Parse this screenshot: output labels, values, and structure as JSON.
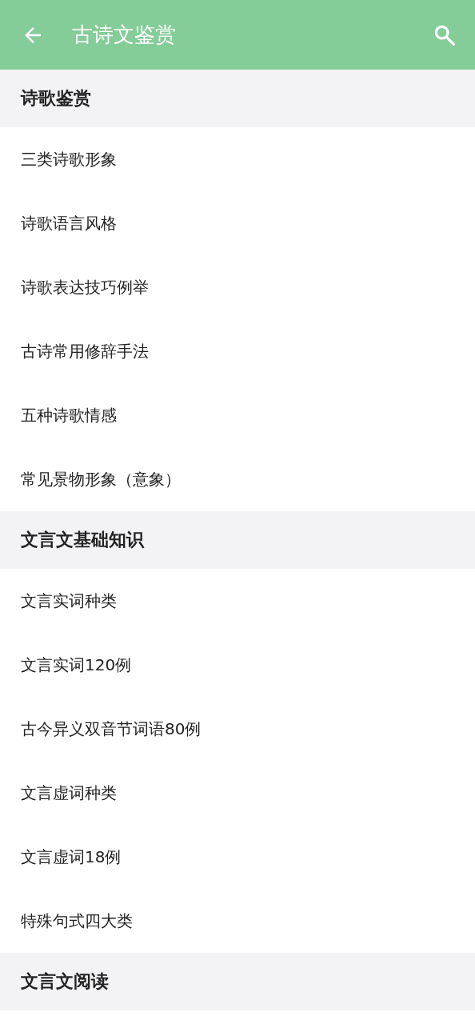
{
  "app_bar": {
    "title": "古诗文鉴赏"
  },
  "sections": [
    {
      "title": "诗歌鉴赏",
      "items": [
        "三类诗歌形象",
        "诗歌语言风格",
        "诗歌表达技巧例举",
        "古诗常用修辞手法",
        "五种诗歌情感",
        "常见景物形象（意象）"
      ]
    },
    {
      "title": "文言文基础知识",
      "items": [
        "文言实词种类",
        "文言实词120例",
        "古今异义双音节词语80例",
        "文言虚词种类",
        "文言虚词18例",
        "特殊句式四大类"
      ]
    },
    {
      "title": "文言文阅读"
    }
  ]
}
